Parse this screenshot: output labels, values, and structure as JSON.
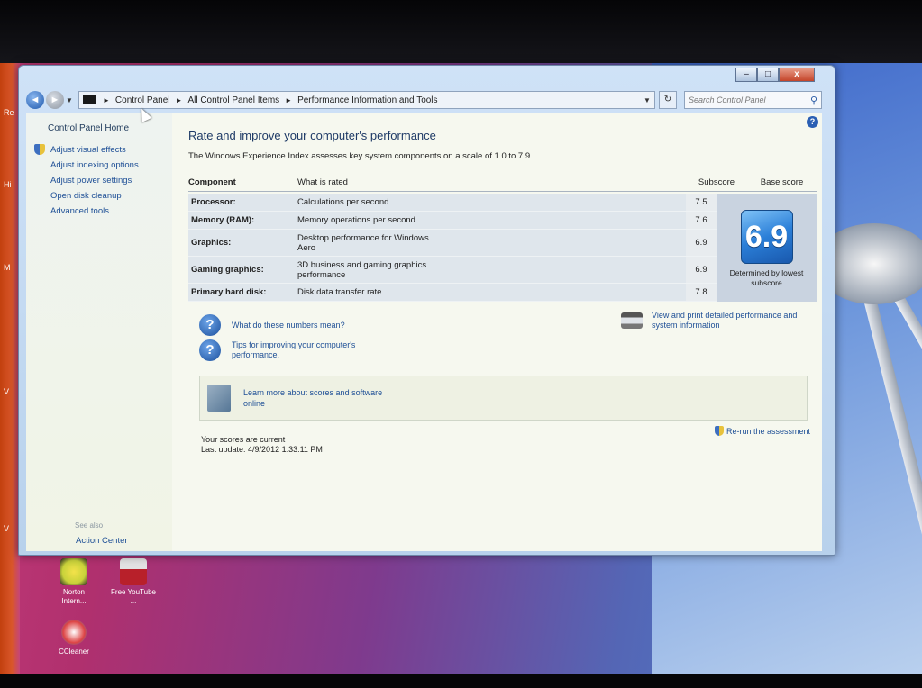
{
  "window": {
    "min_label": "–",
    "max_label": "□",
    "close_label": "x"
  },
  "nav": {
    "back_glyph": "◄",
    "forward_glyph": "►",
    "dropdown_glyph": "▼",
    "breadcrumbs": [
      "Control Panel",
      "All Control Panel Items",
      "Performance Information and Tools"
    ],
    "separator_glyph": "►",
    "refresh_glyph": "↻",
    "search_placeholder": "Search Control Panel",
    "search_glyph": "⚲"
  },
  "sidebar": {
    "home": "Control Panel Home",
    "items": [
      {
        "label": "Adjust visual effects",
        "icon": "shield-icon"
      },
      {
        "label": "Adjust indexing options",
        "icon": ""
      },
      {
        "label": "Adjust power settings",
        "icon": ""
      },
      {
        "label": "Open disk cleanup",
        "icon": ""
      },
      {
        "label": "Advanced tools",
        "icon": ""
      }
    ],
    "see_also": "See also",
    "action_center": "Action Center"
  },
  "main": {
    "help_glyph": "?",
    "heading": "Rate and improve your computer's performance",
    "subtext": "The Windows Experience Index assesses key system components on a scale of 1.0 to 7.9.",
    "table": {
      "headers": [
        "Component",
        "What is rated",
        "Subscore",
        "Base score"
      ],
      "rows": [
        {
          "component": "Processor:",
          "rated": "Calculations per second",
          "subscore": "7.5"
        },
        {
          "component": "Memory (RAM):",
          "rated": "Memory operations per second",
          "subscore": "7.6"
        },
        {
          "component": "Graphics:",
          "rated": "Desktop performance for Windows Aero",
          "subscore": "6.9"
        },
        {
          "component": "Gaming graphics:",
          "rated": "3D business and gaming graphics performance",
          "subscore": "6.9"
        },
        {
          "component": "Primary hard disk:",
          "rated": "Disk data transfer rate",
          "subscore": "7.8"
        }
      ],
      "base_score": "6.9",
      "base_note": "Determined by lowest subscore"
    },
    "links": {
      "numbers": "What do these numbers mean?",
      "tips": "Tips for improving your computer's performance.",
      "print": "View and print detailed performance and system information",
      "question_glyph": "?"
    },
    "learn_more": "Learn more about scores and software online",
    "status_line1": "Your scores are current",
    "status_line2": "Last update: 4/9/2012 1:33:11 PM",
    "rerun": "Re-run the assessment"
  },
  "desktop": {
    "icons": [
      {
        "label": "Norton Intern...",
        "color": "#c8d23a"
      },
      {
        "label": "Free YouTube ...",
        "color": "#b8202a"
      }
    ],
    "ccleaner": "CCleaner",
    "strip_letters": [
      "Re",
      "Hi",
      "M",
      "V",
      "V"
    ]
  }
}
